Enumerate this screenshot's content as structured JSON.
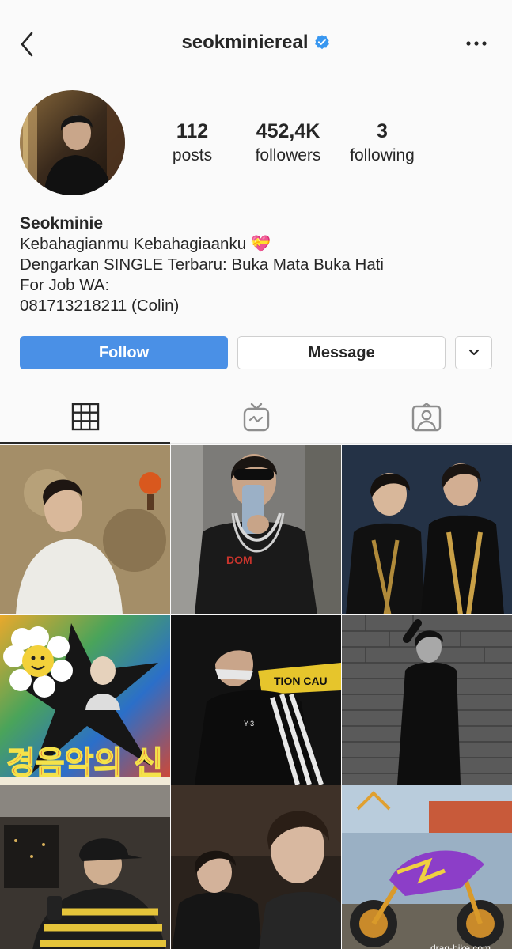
{
  "header": {
    "username": "seokminiereal",
    "back_icon": "chevron-left-icon",
    "verified_icon": "verified-badge-icon",
    "more_icon": "more-horizontal-icon"
  },
  "stats": {
    "posts_count": "112",
    "posts_label": "posts",
    "followers_count": "452,4K",
    "followers_label": "followers",
    "following_count": "3",
    "following_label": "following"
  },
  "bio": {
    "name": "Seokminie",
    "line1": "Kebahagianmu Kebahagiaanku",
    "line1_emoji": "💝",
    "line2": "Dengarkan SINGLE Terbaru: Buka Mata Buka Hati",
    "line3": "For Job WA:",
    "line4": "081713218211 (Colin)"
  },
  "actions": {
    "follow_label": "Follow",
    "message_label": "Message",
    "dropdown_icon": "chevron-down-icon"
  },
  "tabs": [
    {
      "name": "grid",
      "icon": "grid-icon",
      "active": true
    },
    {
      "name": "igtv",
      "icon": "igtv-icon",
      "active": false
    },
    {
      "name": "tagged",
      "icon": "tagged-person-icon",
      "active": false
    }
  ],
  "grid_posts": {
    "post3_text": "경음악의 신",
    "post8_watermark": "drag-bike.com"
  },
  "colors": {
    "follow_blue": "#4a90e6",
    "verified_blue": "#3897f0",
    "text": "#262626",
    "background": "#fafafa"
  }
}
